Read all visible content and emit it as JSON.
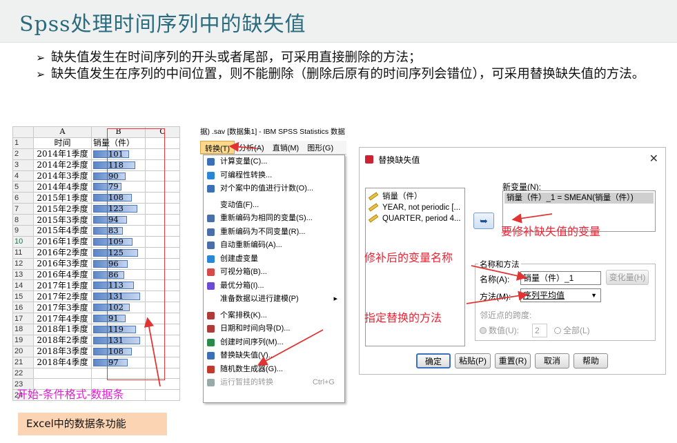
{
  "slide": {
    "title": "Spss处理时间序列中的缺失值",
    "bullets": [
      "缺失值发生在时间序列的开头或者尾部，可采用直接删除的方法；",
      "缺失值发生在序列的中间位置，则不能删除（删除后原有的时间序列会错位），可采用替换缺失值的方法。"
    ]
  },
  "excel": {
    "col_headers": [
      "A",
      "B",
      "C"
    ],
    "header_row": {
      "num": "1",
      "a": "时间",
      "b": "销量（件）"
    },
    "rows": [
      {
        "num": "2",
        "time": "2014年1季度",
        "value": 101
      },
      {
        "num": "3",
        "time": "2014年2季度",
        "value": 118
      },
      {
        "num": "4",
        "time": "2014年3季度",
        "value": 90
      },
      {
        "num": "5",
        "time": "2014年4季度",
        "value": 79
      },
      {
        "num": "6",
        "time": "2015年1季度",
        "value": 108
      },
      {
        "num": "7",
        "time": "2015年2季度",
        "value": 123
      },
      {
        "num": "8",
        "time": "2015年3季度",
        "value": 94
      },
      {
        "num": "9",
        "time": "2015年4季度",
        "value": 83
      },
      {
        "num": "10",
        "time": "2016年1季度",
        "value": 109
      },
      {
        "num": "11",
        "time": "2016年2季度",
        "value": 125
      },
      {
        "num": "12",
        "time": "2016年3季度",
        "value": 96
      },
      {
        "num": "13",
        "time": "2016年4季度",
        "value": 86
      },
      {
        "num": "14",
        "time": "2017年1季度",
        "value": 113
      },
      {
        "num": "15",
        "time": "2017年2季度",
        "value": 131
      },
      {
        "num": "16",
        "time": "2017年3季度",
        "value": 102
      },
      {
        "num": "17",
        "time": "2017年4季度",
        "value": 91
      },
      {
        "num": "18",
        "time": "2018年1季度",
        "value": 119
      },
      {
        "num": "19",
        "time": "2018年2季度",
        "value": 131
      },
      {
        "num": "20",
        "time": "2018年3季度",
        "value": 108
      },
      {
        "num": "21",
        "time": "2018年4季度",
        "value": 97
      }
    ],
    "empty_rows": [
      "22",
      "23",
      "24"
    ],
    "annotation": "开始-条件格式-数据条",
    "caption": "Excel中的数据条功能"
  },
  "spss_menu": {
    "window_title": "据) .sav [数据集1] - IBM SPSS Statistics 数据",
    "menubar": [
      "转换(T)",
      "分析(A)",
      "直销(M)",
      "图形(G)"
    ],
    "items": [
      {
        "label": "计算变量(C)...",
        "icon_color": "#3b6fb6"
      },
      {
        "label": "可编程性转换...",
        "icon_color": "#2a86d6"
      },
      {
        "label": "对个案中的值进行计数(O)...",
        "icon_color": "#3b6fb6"
      },
      {
        "label": "变动值(F)...",
        "icon_color": ""
      },
      {
        "label": "重新编码为相同的变量(S)...",
        "icon_color": "#4a6fa8"
      },
      {
        "label": "重新编码为不同变量(R)...",
        "icon_color": "#4a6fa8"
      },
      {
        "label": "自动重新编码(A)...",
        "icon_color": "#4a6fa8"
      },
      {
        "label": "创建虚变量",
        "icon_color": "#2a86d6"
      },
      {
        "label": "可视分箱(B)...",
        "icon_color": "#d64a4a"
      },
      {
        "label": "最优分箱(I)...",
        "icon_color": "#6a4ad6"
      },
      {
        "label": "准备数据以进行建模(P)",
        "icon_color": ""
      },
      {
        "label": "个案排秩(K)...",
        "icon_color": "#b03a3a"
      },
      {
        "label": "日期和时间向导(D)...",
        "icon_color": "#b03a3a"
      },
      {
        "label": "创建时间序列(M)...",
        "icon_color": "#2a8a4a"
      },
      {
        "label": "替换缺失值(V)...",
        "icon_color": "#3b6fb6"
      },
      {
        "label": "随机数生成器(G)...",
        "icon_color": "#c0392b"
      },
      {
        "label": "运行暂挂的转换",
        "icon_color": "#9aa"
      }
    ],
    "shortcut": "Ctrl+G"
  },
  "dialog": {
    "title": "替换缺失值",
    "variables": [
      "销量（件）",
      "YEAR, not periodic [...",
      "QUARTER, period 4..."
    ],
    "new_var_label": "新变量(N):",
    "new_var_value": "销量（件）_1 = SMEAN(销量（件）)",
    "group_label": "名称和方法",
    "name_label": "名称(A):",
    "name_value": "销量（件）_1",
    "change_btn": "变化量(H)",
    "method_label": "方法(M):",
    "method_value": "序列平均值",
    "span_label": "邻近点的跨度:",
    "number_radio": "数值(U):",
    "number_value": "2",
    "all_radio": "全部(L)",
    "buttons": [
      "确定",
      "粘贴(P)",
      "重置(R)",
      "取消",
      "帮助"
    ]
  },
  "annotations": {
    "variable_note": "要修补缺失值的变量",
    "name_note": "修补后的变量名称",
    "method_note": "指定替换的方法"
  },
  "colors": {
    "annotation": "#e23333",
    "title": "#2a6b7f",
    "excel_note": "#e020d0"
  }
}
